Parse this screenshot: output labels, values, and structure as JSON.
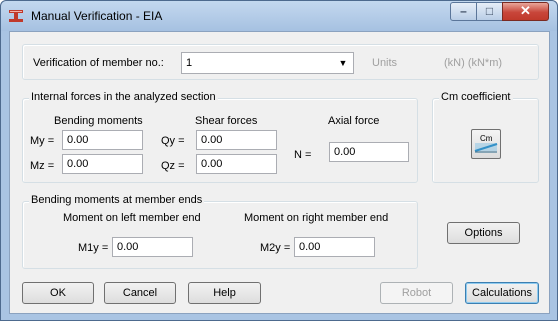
{
  "window": {
    "title": "Manual Verification - EIA",
    "minimize": "–",
    "maximize": "□",
    "close": "✕"
  },
  "member": {
    "label": "Verification of member no.:",
    "value": "1",
    "units_label": "Units",
    "units_value": "(kN) (kN*m)"
  },
  "internal_forces": {
    "title": "Internal forces in the analyzed section",
    "bending_title": "Bending moments",
    "shear_title": "Shear forces",
    "axial_title": "Axial force",
    "my_label": "My =",
    "my_value": "0.00",
    "mz_label": "Mz =",
    "mz_value": "0.00",
    "qy_label": "Qy =",
    "qy_value": "0.00",
    "qz_label": "Qz =",
    "qz_value": "0.00",
    "n_label": "N =",
    "n_value": "0.00"
  },
  "cm": {
    "title": "Cm coefficient",
    "button_text": "Cm"
  },
  "member_ends": {
    "title": "Bending moments at member ends",
    "left_title": "Moment on left member end",
    "right_title": "Moment on right member end",
    "m1y_label": "M1y =",
    "m1y_value": "0.00",
    "m2y_label": "M2y =",
    "m2y_value": "0.00"
  },
  "buttons": {
    "options": "Options",
    "ok": "OK",
    "cancel": "Cancel",
    "help": "Help",
    "robot": "Robot",
    "calculations": "Calculations"
  },
  "colors": {
    "title_bar": "#a9c4e3",
    "dialog_bg": "#f0f0f0",
    "close_button": "#c0392b",
    "default_button_border": "#3c7fb1"
  }
}
